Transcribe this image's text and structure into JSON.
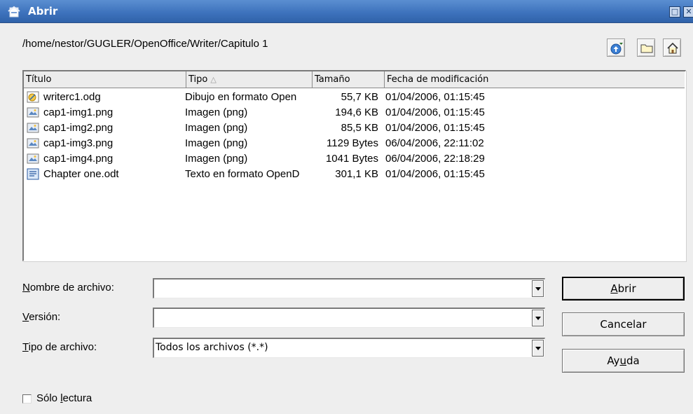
{
  "window": {
    "title": "Abrir",
    "maximize_glyph": "□",
    "close_glyph": "✕"
  },
  "path": "/home/nestor/GUGLER/OpenOffice/Writer/Capitulo 1",
  "toolbar": {
    "icons": [
      "up-one-level-icon",
      "new-folder-icon",
      "default-directory-icon"
    ]
  },
  "file_list": {
    "columns": [
      "Título",
      "Tipo",
      "Tamaño",
      "Fecha de modificación"
    ],
    "sort_indicator": "△",
    "rows": [
      {
        "name": "writerc1.odg",
        "type": "Dibujo en formato Open",
        "size": "55,7 KB",
        "date": "01/04/2006, 01:15:45",
        "icon": "drawing-file-icon"
      },
      {
        "name": "cap1-img1.png",
        "type": "Imagen (png)",
        "size": "194,6 KB",
        "date": "01/04/2006, 01:15:45",
        "icon": "image-file-icon"
      },
      {
        "name": "cap1-img2.png",
        "type": "Imagen (png)",
        "size": "85,5 KB",
        "date": "01/04/2006, 01:15:45",
        "icon": "image-file-icon"
      },
      {
        "name": "cap1-img3.png",
        "type": "Imagen (png)",
        "size": "1129 Bytes",
        "date": "06/04/2006, 22:11:02",
        "icon": "image-file-icon"
      },
      {
        "name": "cap1-img4.png",
        "type": "Imagen (png)",
        "size": "1041 Bytes",
        "date": "06/04/2006, 22:18:29",
        "icon": "image-file-icon"
      },
      {
        "name": "Chapter one.odt",
        "type": "Texto en formato OpenD",
        "size": "301,1 KB",
        "date": "01/04/2006, 01:15:45",
        "icon": "text-document-icon"
      }
    ]
  },
  "form": {
    "filename": {
      "label_first": "N",
      "label_rest": "ombre de archivo:",
      "value": ""
    },
    "version": {
      "label_first": "V",
      "label_rest": "ersión:",
      "value": ""
    },
    "filetype": {
      "label_first": "T",
      "label_rest": "ipo de archivo:",
      "value": "Todos los archivos (*.*)"
    }
  },
  "buttons": {
    "open": {
      "mnemonic": "A",
      "rest": "brir"
    },
    "cancel": "Cancelar",
    "help": {
      "before": "Ay",
      "mnemonic": "u",
      "after": "da"
    }
  },
  "readonly": {
    "label_before": "Sólo ",
    "mnemonic": "l",
    "label_after": "ectura",
    "checked": false
  }
}
